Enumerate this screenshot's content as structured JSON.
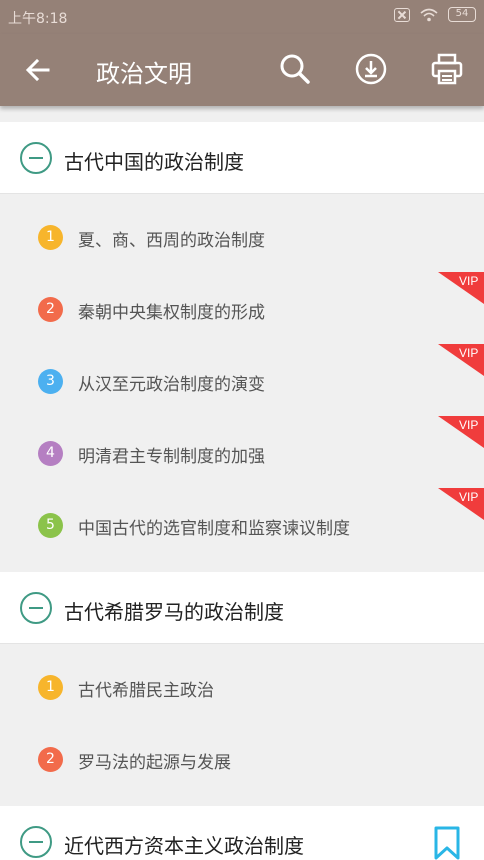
{
  "status": {
    "time": "上午8:18",
    "battery": "54"
  },
  "appbar": {
    "title": "政治文明"
  },
  "sections": [
    {
      "title": "古代中国的政治制度",
      "items": [
        {
          "num": "1",
          "text": "夏、商、西周的政治制度",
          "color": "#f7b52c",
          "vip": false
        },
        {
          "num": "2",
          "text": "秦朝中央集权制度的形成",
          "color": "#f26b4b",
          "vip": true
        },
        {
          "num": "3",
          "text": "从汉至元政治制度的演变",
          "color": "#4cb0f0",
          "vip": true
        },
        {
          "num": "4",
          "text": "明清君主专制制度的加强",
          "color": "#b57fc2",
          "vip": true
        },
        {
          "num": "5",
          "text": "中国古代的选官制度和监察谏议制度",
          "color": "#8bc34a",
          "vip": true
        }
      ]
    },
    {
      "title": "古代希腊罗马的政治制度",
      "items": [
        {
          "num": "1",
          "text": "古代希腊民主政治",
          "color": "#f7b52c",
          "vip": false
        },
        {
          "num": "2",
          "text": "罗马法的起源与发展",
          "color": "#f26b4b",
          "vip": false
        }
      ]
    },
    {
      "title": "近代西方资本主义政治制度",
      "items": []
    }
  ],
  "vip_label": "VIP",
  "colors": {
    "header": "#958177",
    "accent": "#3f9a84",
    "vip": "#f03c3c",
    "bookmark": "#29b6e6"
  }
}
